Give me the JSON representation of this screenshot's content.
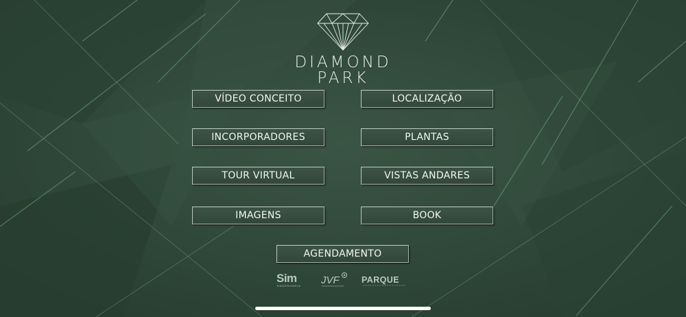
{
  "brand": {
    "line1": "DIAMOND",
    "line2": "PARK",
    "icon": "diamond-icon"
  },
  "menu": {
    "video_conceito": "VÍDEO CONCEITO",
    "localizacao": "LOCALIZAÇÃO",
    "incorporadores": "INCORPORADORES",
    "plantas": "PLANTAS",
    "tour_virtual": "TOUR VIRTUAL",
    "vistas_andares": "VISTAS ANDARES",
    "imagens": "IMAGENS",
    "book": "BOOK",
    "agendamento": "AGENDAMENTO"
  },
  "partners": {
    "sim": "Sim",
    "sim_sub": "ENGENHARIA",
    "jvf": "JVF",
    "parque": "PARQUE"
  },
  "colors": {
    "background": "#2f4838",
    "button_border": "#a9b6ad",
    "text": "#f3f6f4"
  }
}
